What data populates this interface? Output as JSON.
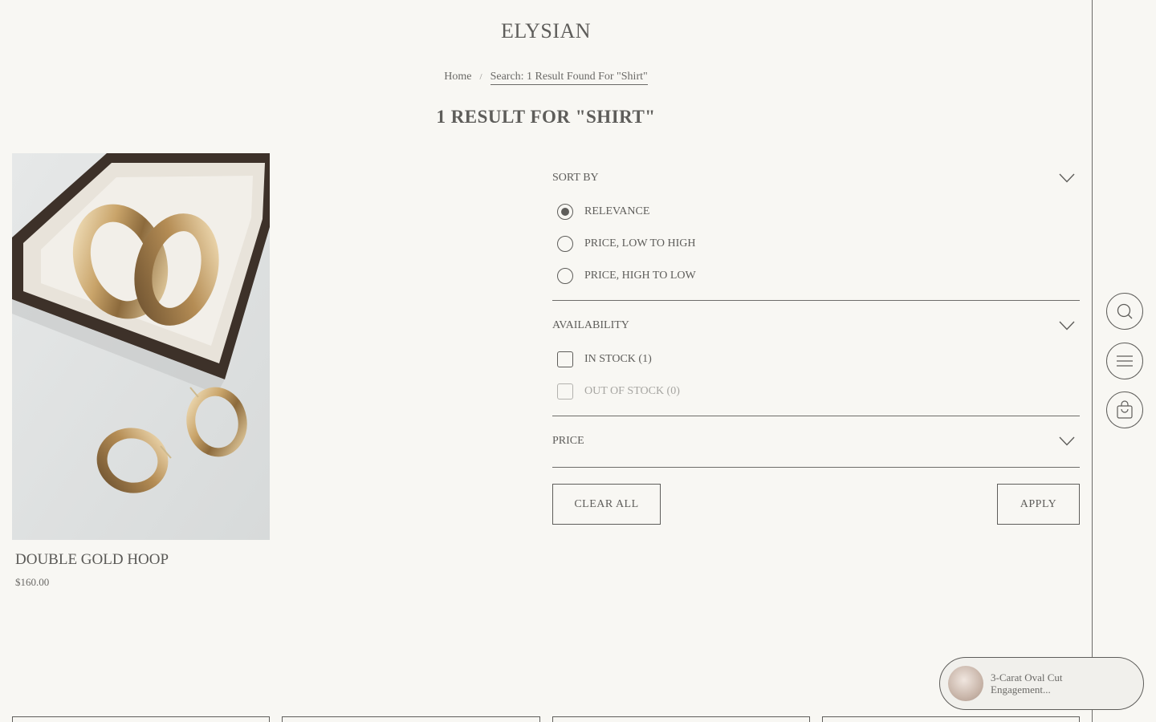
{
  "brand": {
    "logo": "ELYSIAN"
  },
  "breadcrumb": {
    "home": "Home",
    "separator": "/",
    "current": "Search: 1 Result Found For \"Shirt\""
  },
  "page_title": "1 RESULT FOR \"SHIRT\"",
  "product": {
    "name": "DOUBLE GOLD HOOP",
    "price": "$160.00",
    "image": "gold-hoop-earrings-in-box"
  },
  "filters": {
    "sort": {
      "title": "SORT BY",
      "options": [
        {
          "label": "RELEVANCE",
          "selected": true
        },
        {
          "label": "PRICE, LOW TO HIGH",
          "selected": false
        },
        {
          "label": "PRICE, HIGH TO LOW",
          "selected": false
        }
      ]
    },
    "availability": {
      "title": "AVAILABILITY",
      "options": [
        {
          "label": "IN STOCK (1)",
          "checked": false,
          "disabled": false
        },
        {
          "label": "OUT OF STOCK (0)",
          "checked": false,
          "disabled": true
        }
      ]
    },
    "price": {
      "title": "PRICE"
    },
    "clear_label": "CLEAR ALL",
    "apply_label": "APPLY"
  },
  "side_actions": {
    "search": "search-icon",
    "menu": "menu-icon",
    "cart": "cart-icon"
  },
  "recently_viewed": {
    "title": "3-Carat Oval Cut Engagement..."
  },
  "colors": {
    "background": "#f8f7f3",
    "text": "#5e5d5a",
    "line": "#6d6c69"
  }
}
